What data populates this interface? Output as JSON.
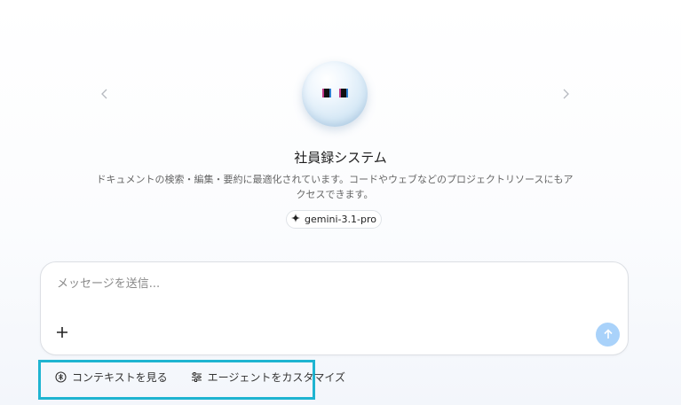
{
  "agent": {
    "name": "社員録システム",
    "description": "ドキュメントの検索・編集・要約に最適化されています。コードやウェブなどのプロジェクトリソースにもアクセスできます。",
    "model": "gemini-3.1-pro",
    "avatar_icon": "robot-orb-avatar"
  },
  "carousel": {
    "prev_icon": "chevron-left-icon",
    "next_icon": "chevron-right-icon"
  },
  "composer": {
    "placeholder": "メッセージを送信...",
    "value": "",
    "attach_icon": "plus-icon",
    "send_icon": "arrow-up-icon",
    "send_color": "#a9d2fa"
  },
  "footer": {
    "view_context_label": "コンテキストを見る",
    "customize_agent_label": "エージェントをカスタマイズ",
    "view_context_icon": "context-icon",
    "customize_icon": "sliders-icon",
    "highlight_color": "#1fb4d1"
  }
}
